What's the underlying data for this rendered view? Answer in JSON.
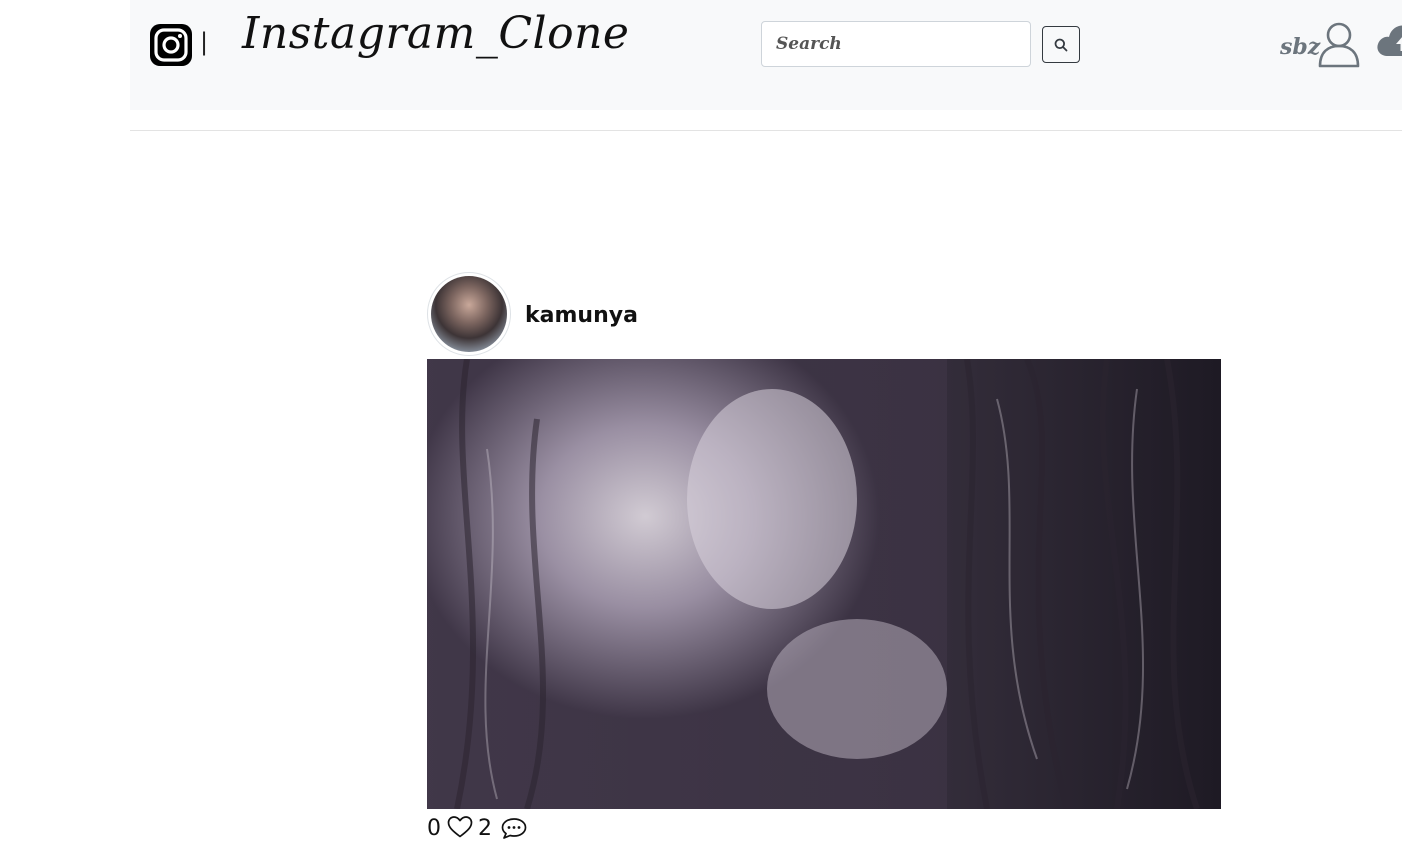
{
  "navbar": {
    "brand_title": "Instagram_Clone",
    "brand_separator": "|",
    "search": {
      "placeholder": "Search",
      "value": ""
    },
    "username": "sbz"
  },
  "post": {
    "author": "kamunya",
    "likes_count": "0",
    "comments_count": "2"
  },
  "icons": {
    "logo": "instagram-icon",
    "search": "search-icon",
    "profile": "user-icon",
    "upload": "cloud-upload-icon",
    "like": "heart-icon",
    "comment": "comment-icon"
  }
}
